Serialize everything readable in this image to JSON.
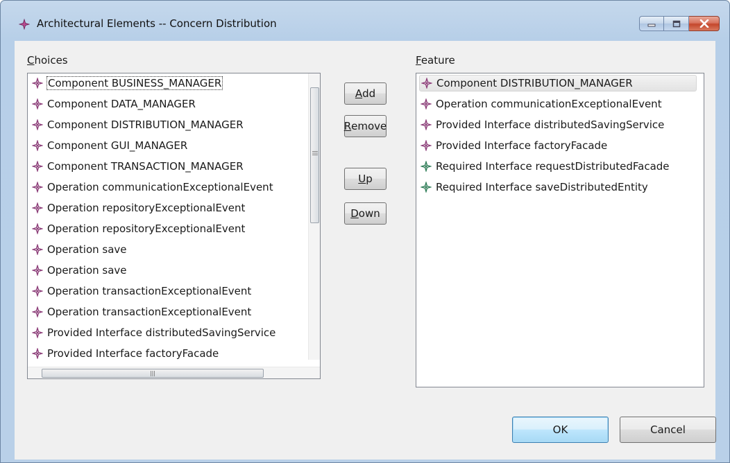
{
  "window": {
    "title": "Architectural Elements -- Concern Distribution",
    "icon": "plugin-diamond-icon",
    "controls": [
      "minimize-icon",
      "maximize-icon",
      "close-icon"
    ]
  },
  "choices": {
    "label_mnemonic": "C",
    "label_rest": "hoices",
    "items": [
      {
        "label": "Component BUSINESS_MANAGER",
        "icon": "component-diamond-icon",
        "focused": true
      },
      {
        "label": "Component DATA_MANAGER",
        "icon": "component-diamond-icon"
      },
      {
        "label": "Component DISTRIBUTION_MANAGER",
        "icon": "component-diamond-icon"
      },
      {
        "label": "Component GUI_MANAGER",
        "icon": "component-diamond-icon"
      },
      {
        "label": "Component TRANSACTION_MANAGER",
        "icon": "component-diamond-icon"
      },
      {
        "label": "Operation communicationExceptionalEvent",
        "icon": "operation-diamond-icon"
      },
      {
        "label": "Operation repositoryExceptionalEvent",
        "icon": "operation-diamond-icon"
      },
      {
        "label": "Operation repositoryExceptionalEvent",
        "icon": "operation-diamond-icon"
      },
      {
        "label": "Operation save",
        "icon": "operation-diamond-icon"
      },
      {
        "label": "Operation save",
        "icon": "operation-diamond-icon"
      },
      {
        "label": "Operation transactionExceptionalEvent",
        "icon": "operation-diamond-icon"
      },
      {
        "label": "Operation transactionExceptionalEvent",
        "icon": "operation-diamond-icon"
      },
      {
        "label": "Provided Interface distributedSavingService",
        "icon": "interface-diamond-icon"
      },
      {
        "label": "Provided Interface factoryFacade",
        "icon": "interface-diamond-icon"
      }
    ]
  },
  "feature": {
    "label_mnemonic": "F",
    "label_rest": "eature",
    "items": [
      {
        "label": "Component DISTRIBUTION_MANAGER",
        "icon": "component-diamond-icon",
        "selected": true
      },
      {
        "label": "Operation communicationExceptionalEvent",
        "icon": "operation-diamond-icon"
      },
      {
        "label": "Provided Interface distributedSavingService",
        "icon": "interface-diamond-icon"
      },
      {
        "label": "Provided Interface factoryFacade",
        "icon": "interface-diamond-icon"
      },
      {
        "label": "Required Interface requestDistributedFacade",
        "icon": "required-interface-diamond-icon"
      },
      {
        "label": "Required Interface saveDistributedEntity",
        "icon": "required-interface-diamond-icon"
      }
    ]
  },
  "buttons": {
    "add": {
      "mnemonic": "A",
      "rest": "dd"
    },
    "remove": {
      "mnemonic": "R",
      "rest": "emove"
    },
    "up": {
      "mnemonic": "U",
      "rest": "p"
    },
    "down": {
      "mnemonic": "D",
      "rest": "own"
    },
    "ok": "OK",
    "cancel": "Cancel"
  },
  "colors": {
    "diamond_purple": "#8c3c78",
    "diamond_green": "#2e7d57",
    "title_gradient_top": "#c5d8ec",
    "dialog_bg": "#f0f0f0"
  }
}
